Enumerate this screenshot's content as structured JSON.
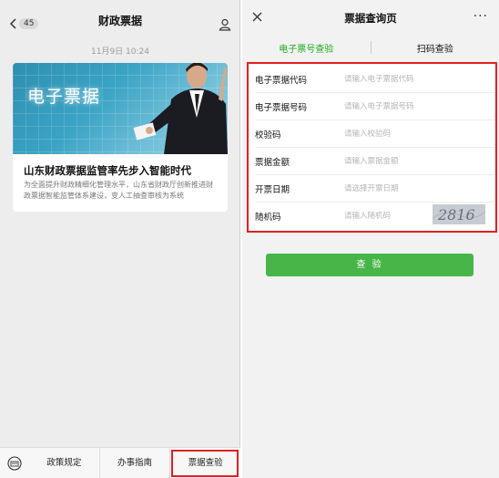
{
  "left": {
    "header": {
      "back_badge": "45",
      "title": "财政票据"
    },
    "timestamp": "11月9日 10:24",
    "article": {
      "banner_text": "电子票据",
      "title": "山东财政票据监管率先步入智能时代",
      "description": "为全面提升财政精细化管理水平，山东省财政厅创新推进财政票据智能监管体系建设，变人工抽查审核为系统"
    },
    "menu": {
      "items": [
        {
          "label": "政策规定"
        },
        {
          "label": "办事指南"
        },
        {
          "label": "票据查验"
        }
      ]
    }
  },
  "right": {
    "header": {
      "title": "票据查询页",
      "more": "···"
    },
    "tabs": [
      {
        "label": "电子票号查验",
        "active": true
      },
      {
        "label": "扫码查验",
        "active": false
      }
    ],
    "form": {
      "fields": [
        {
          "label": "电子票据代码",
          "placeholder": "请输入电子票据代码"
        },
        {
          "label": "电子票据号码",
          "placeholder": "请输入电子票据号码"
        },
        {
          "label": "校验码",
          "placeholder": "请输入校验码"
        },
        {
          "label": "票据金额",
          "placeholder": "请输入票据金额"
        },
        {
          "label": "开票日期",
          "placeholder": "请选择开票日期"
        },
        {
          "label": "随机码",
          "placeholder": "请输入随机码"
        }
      ],
      "captcha_text": "2816"
    },
    "verify_button": "查 验"
  },
  "colors": {
    "accent_green": "#1aad19",
    "button_green": "#48b548",
    "highlight_red": "#e02020"
  }
}
